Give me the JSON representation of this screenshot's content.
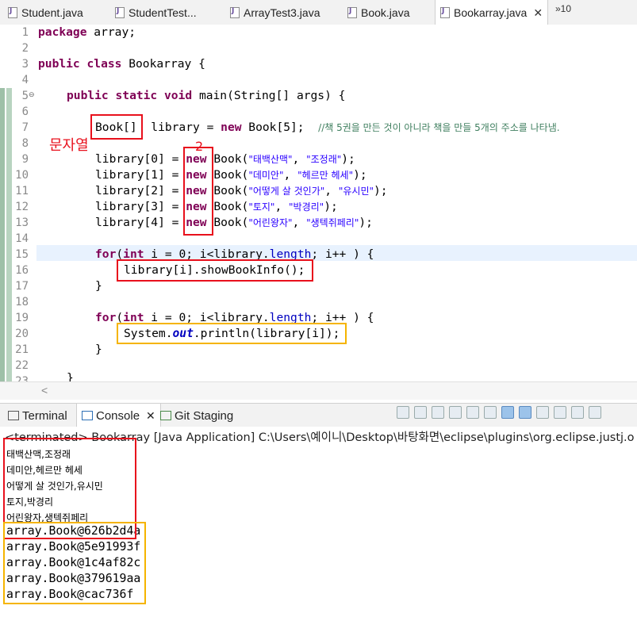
{
  "tabs": [
    {
      "label": "Student.java",
      "active": false
    },
    {
      "label": "StudentTest...",
      "active": false
    },
    {
      "label": "ArrayTest3.java",
      "active": false
    },
    {
      "label": "Book.java",
      "active": false
    },
    {
      "label": "Bookarray.java",
      "active": true
    }
  ],
  "tab_overflow": "»10",
  "editor": {
    "line_numbers": [
      "1",
      "2",
      "3",
      "4",
      "5",
      "6",
      "7",
      "8",
      "9",
      "10",
      "11",
      "12",
      "13",
      "14",
      "15",
      "16",
      "17",
      "18",
      "19",
      "20",
      "21",
      "22",
      "23"
    ],
    "code": {
      "l1_kw": "package",
      "l1_rest": " array;",
      "l3_kw": "public class",
      "l3_rest": " Bookarray {",
      "l5_kw": "public static void",
      "l5_rest": " main(String[] args) {",
      "l7_type": "Book[]",
      "l7_mid": "  library = ",
      "l7_new": "new",
      "l7_rest": " Book[5];  ",
      "l7_comment": "//책 5권을 만든 것이 아니라 책을 만들 5개의 주소를 나타냄.",
      "books": [
        {
          "idx": "library[0] = ",
          "title": "\"태백산맥\"",
          "author": "\"조정래\""
        },
        {
          "idx": "library[1] = ",
          "title": "\"데미안\"",
          "author": "\"헤르만 헤세\""
        },
        {
          "idx": "library[2] = ",
          "title": "\"어떻게 살 것인가\"",
          "author": "\"유시민\""
        },
        {
          "idx": "library[3] = ",
          "title": "\"토지\"",
          "author": "\"박경리\""
        },
        {
          "idx": "library[4] = ",
          "title": "\"어린왕자\"",
          "author": "\"생텍쥐페리\""
        }
      ],
      "new_kw": "new",
      "book_call": " Book(",
      "comma": ", ",
      "close": ");",
      "for_kw": "for",
      "for_int": "int",
      "for_rest1": "(",
      "for_rest2": " i = 0; i<library.",
      "length": "length",
      "for_rest3": "; i++ ) {",
      "l16": "library[i].showBookInfo();",
      "brace": "}",
      "l20_a": "System.",
      "l20_out": "out",
      "l20_b": ".println(library[i]);",
      "l23": "}"
    },
    "annotations": {
      "label_red": "문자열",
      "label_two": "2"
    }
  },
  "panel": {
    "tabs": [
      {
        "label": "Terminal",
        "active": false
      },
      {
        "label": "Console",
        "active": true,
        "close": "✕"
      },
      {
        "label": "Git Staging",
        "active": false
      }
    ],
    "status": "<terminated> Bookarray [Java Application] C:\\Users\\예이니\\Desktop\\바탕화면\\eclipse\\plugins\\org.eclipse.justj.o",
    "output_korean": [
      "태백산맥,조정래",
      "데미안,헤르만 헤세",
      "어떻게 살 것인가,유시민",
      "토지,박경리",
      "어린왕자,생텍쥐페리"
    ],
    "output_objects": [
      "array.Book@626b2d4a",
      "array.Book@5e91993f",
      "array.Book@1c4af82c",
      "array.Book@379619aa",
      "array.Book@cac736f"
    ]
  },
  "colors": {
    "annotation_red": "#e8101c",
    "annotation_orange": "#f5b400",
    "keyword": "#7f0055",
    "string": "#2a00ff",
    "comment": "#3f7f5f",
    "field": "#0000c0"
  }
}
